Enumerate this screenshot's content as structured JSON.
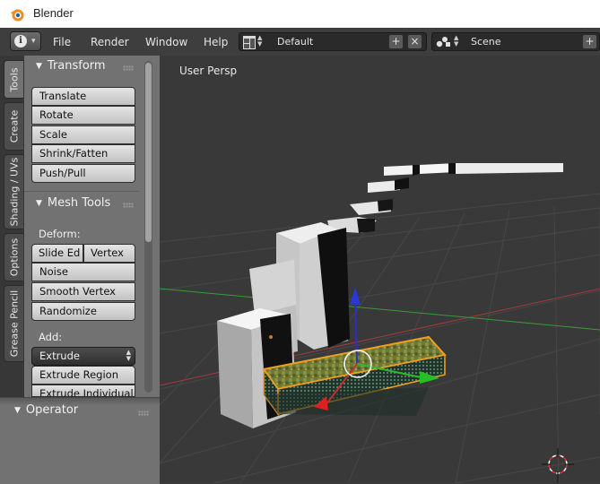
{
  "window": {
    "title": "Blender",
    "logo_icon": "blender-logo-icon"
  },
  "menubar": {
    "info_icon": "info-icon",
    "menus": [
      "File",
      "Render",
      "Window",
      "Help"
    ],
    "screen_layout": {
      "icon": "layout-grid-icon",
      "value": "Default"
    },
    "scene": {
      "icon": "scene-icon",
      "value": "Scene"
    }
  },
  "side_tabs": [
    "Tools",
    "Create",
    "Shading / UVs",
    "Options",
    "Grease Pencil"
  ],
  "tool_shelf": {
    "transform": {
      "title": "Transform",
      "buttons": [
        "Translate",
        "Rotate",
        "Scale",
        "Shrink/Fatten",
        "Push/Pull"
      ]
    },
    "mesh_tools": {
      "title": "Mesh Tools",
      "deform_label": "Deform:",
      "deform_pair": [
        "Slide Ed",
        "Vertex"
      ],
      "deform_buttons": [
        "Noise",
        "Smooth Vertex",
        "Randomize"
      ],
      "add_label": "Add:",
      "add_dropdown": "Extrude",
      "add_buttons": [
        "Extrude Region",
        "Extrude Individual"
      ]
    },
    "scroll_position": 0.0
  },
  "operator_panel": {
    "title": "Operator"
  },
  "viewport": {
    "label": "User Persp"
  },
  "colors": {
    "viewport_bg": "#393939",
    "x_axis": "#a33a3a",
    "y_axis": "#3a9a3a",
    "selection_outline": "#f0a01e"
  }
}
